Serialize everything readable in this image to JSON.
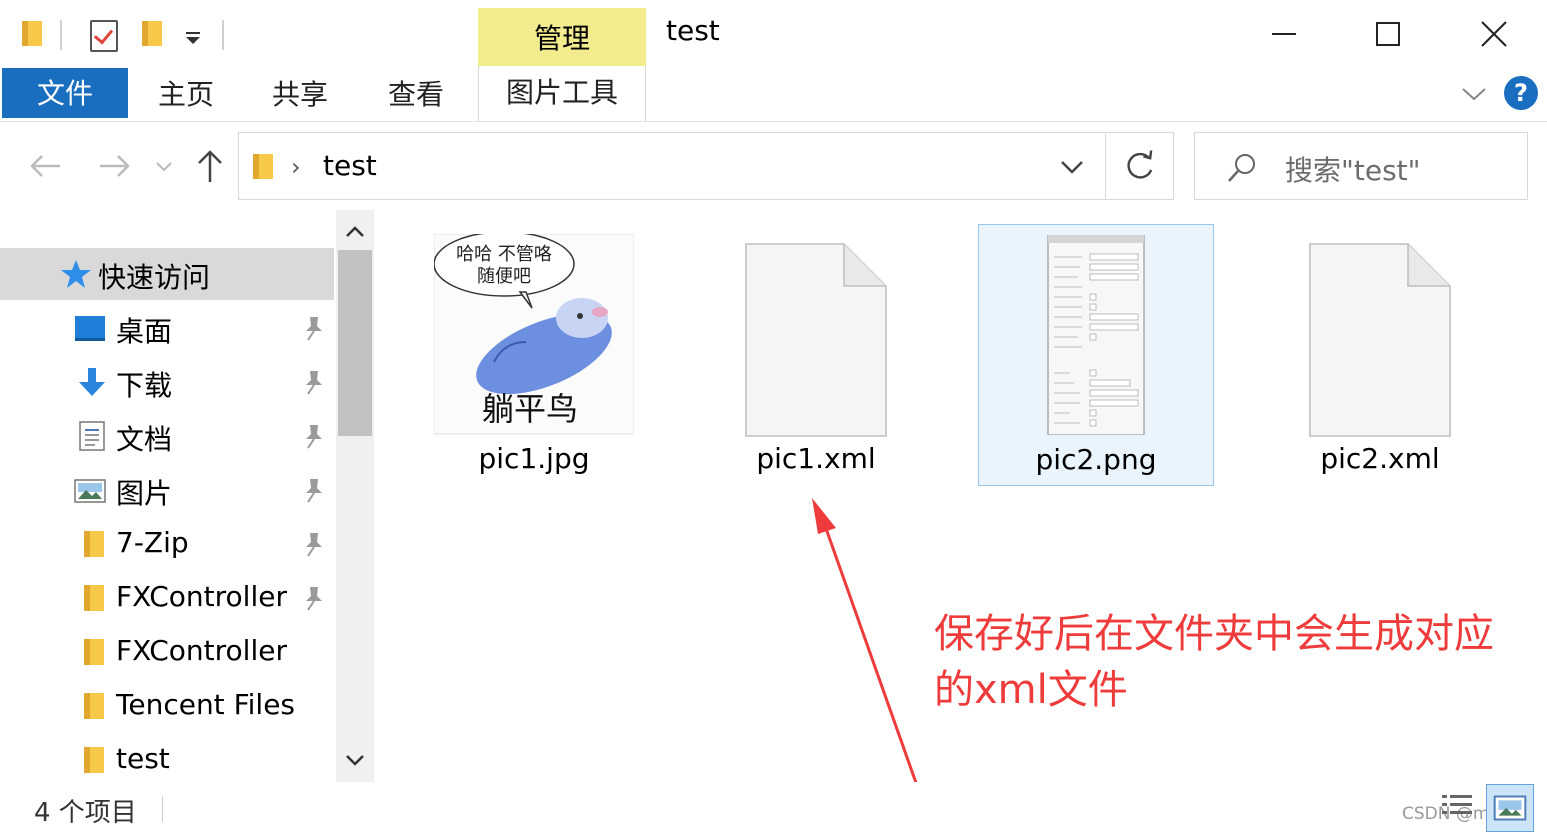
{
  "window": {
    "title": "test",
    "context_tab": "管理",
    "colors": {
      "accent": "#1a6ec0",
      "context_tab_bg": "#f2ec8f",
      "annotation": "#ee3b3b"
    }
  },
  "ribbon": {
    "tabs": [
      "文件",
      "主页",
      "共享",
      "查看",
      "图片工具"
    ],
    "help_label": "?"
  },
  "address": {
    "path": "test",
    "search_placeholder": "搜索\"test\""
  },
  "sidebar": {
    "quick_access": "快速访问",
    "items": [
      {
        "label": "桌面",
        "icon": "desktop-icon",
        "pinned": true
      },
      {
        "label": "下载",
        "icon": "download-icon",
        "pinned": true
      },
      {
        "label": "文档",
        "icon": "document-icon",
        "pinned": true
      },
      {
        "label": "图片",
        "icon": "pictures-icon",
        "pinned": true
      },
      {
        "label": "7-Zip",
        "icon": "folder-icon",
        "pinned": true
      },
      {
        "label": "FXController",
        "icon": "folder-icon",
        "pinned": true
      },
      {
        "label": "FXController",
        "icon": "folder-icon",
        "pinned": false
      },
      {
        "label": "Tencent Files",
        "icon": "folder-icon",
        "pinned": false
      },
      {
        "label": "test",
        "icon": "folder-icon",
        "pinned": false
      }
    ]
  },
  "files": [
    {
      "name": "pic1.jpg",
      "thumb": "meme-image",
      "meme_top": "哈哈 不管咯",
      "meme_mid": "随便吧",
      "meme_bottom": "躺平鸟"
    },
    {
      "name": "pic1.xml",
      "thumb": "blank-file-icon"
    },
    {
      "name": "pic2.png",
      "thumb": "properties-panel-image",
      "selected": true
    },
    {
      "name": "pic2.xml",
      "thumb": "blank-file-icon"
    }
  ],
  "annotation": {
    "line1": "保存好后在文件夹中会生成对应",
    "line2": "的xml文件"
  },
  "status": {
    "count": "4 个项目",
    "watermark": "CSDN @mgdad"
  }
}
